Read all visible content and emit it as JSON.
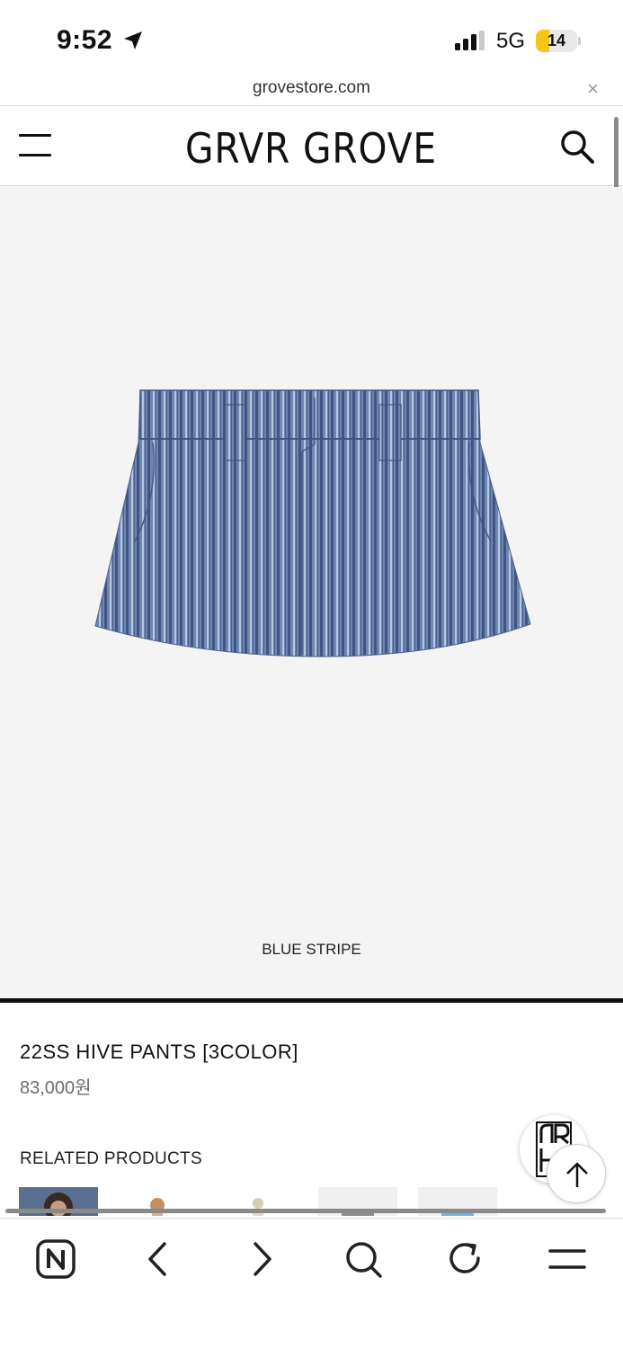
{
  "status_bar": {
    "time": "9:52",
    "network": "5G",
    "battery": "14",
    "battery_color": "#f5c518",
    "icons": [
      "location-arrow-icon",
      "signal-bars-icon",
      "battery-icon"
    ]
  },
  "browser": {
    "url": "grovestore.com",
    "close_icon": "×"
  },
  "site": {
    "logo": "GRVR GROVE",
    "icons": [
      "hamburger-menu-icon",
      "search-icon"
    ]
  },
  "product": {
    "image_caption": "BLUE STRIPE",
    "title": "22SS HIVE PANTS [3COLOR]",
    "price": "83,000원",
    "color": "#6f86b3"
  },
  "related": {
    "heading": "RELATED PRODUCTS"
  },
  "toolbar": {
    "buttons": [
      "naver-home-icon",
      "back-arrow-icon",
      "forward-arrow-icon",
      "search-icon",
      "refresh-icon",
      "menu-icon"
    ]
  }
}
